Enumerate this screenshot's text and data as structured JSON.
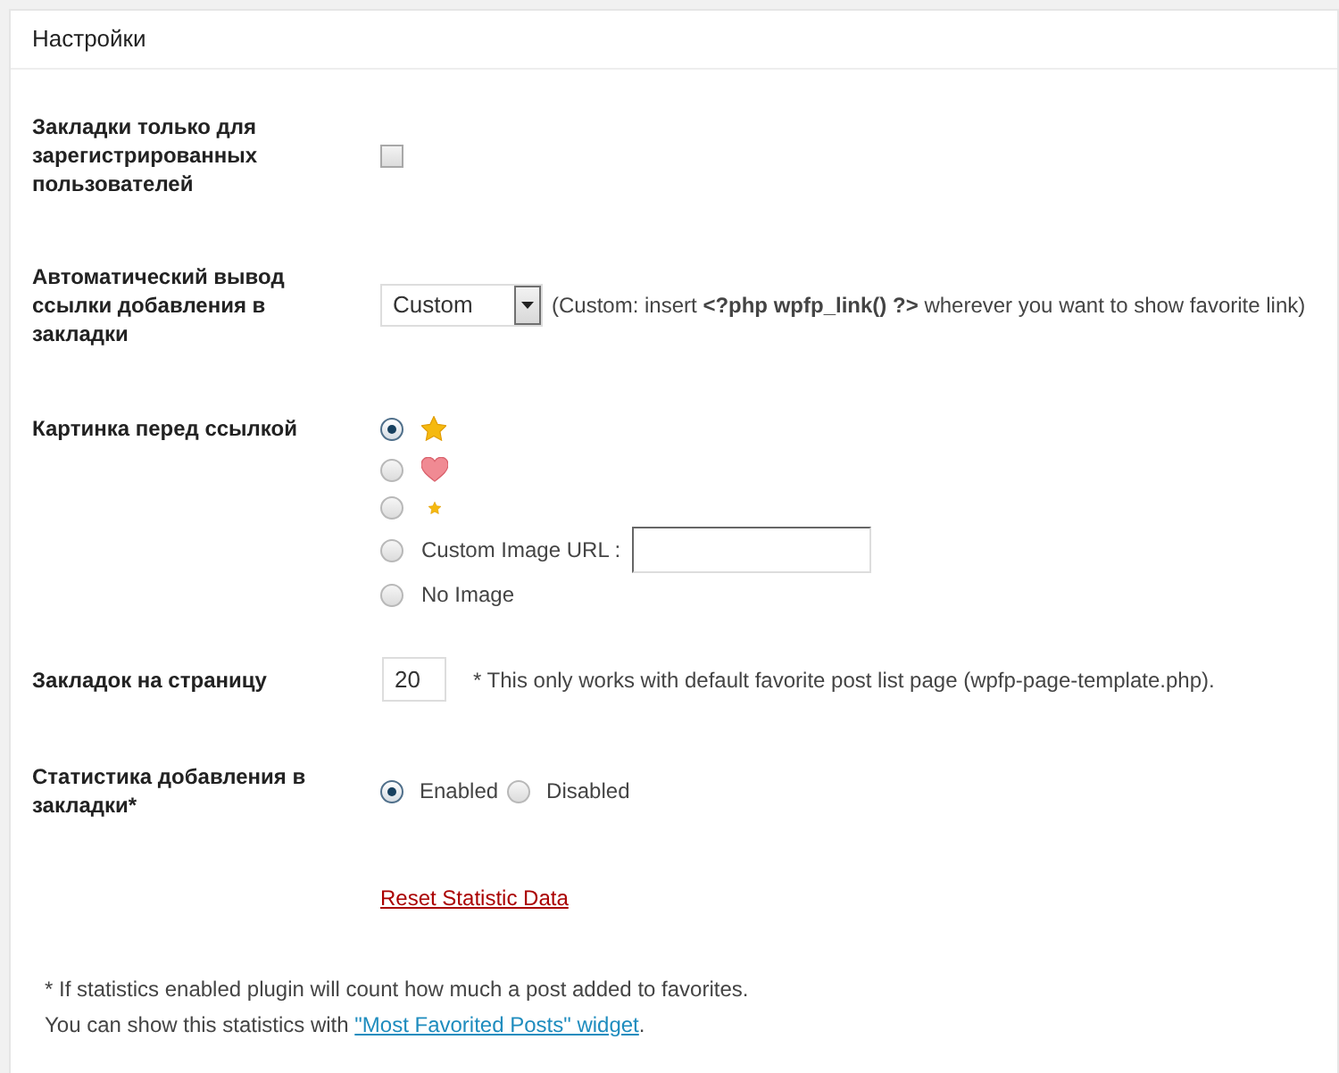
{
  "panel": {
    "title": "Настройки"
  },
  "settings": [
    {
      "kind": "checkbox",
      "label": "Закладки только для зарегистрированных пользователей",
      "checked": false
    },
    {
      "kind": "select",
      "label": "Автоматический вывод ссылки добавления в закладки",
      "value": "Custom",
      "note": "(Custom: insert **<?php wpfp_link() ?>** wherever you want to show favorite link)"
    },
    {
      "kind": "image_choice",
      "label": "Картинка перед ссылкой",
      "options": [
        {
          "kind": "star",
          "selected": true
        },
        {
          "kind": "heart",
          "selected": false
        },
        {
          "kind": "small_star",
          "selected": false
        },
        {
          "kind": "custom_url",
          "label": "Custom Image URL :",
          "selected": false
        },
        {
          "kind": "none",
          "label": "No Image",
          "selected": false
        }
      ]
    },
    {
      "kind": "number",
      "label": "Закладок на страницу",
      "value": "20",
      "note": "* This only works with default favorite post list page (wpfp-page-template.php)."
    },
    {
      "kind": "radio",
      "label": "Статистика добавления в закладки*",
      "options": [
        {
          "label": "Enabled",
          "selected": true
        },
        {
          "label": "Disabled",
          "selected": false
        }
      ]
    },
    {
      "kind": "link",
      "link": "Reset Statistic Data"
    }
  ],
  "footnote": {
    "line_1": "* If statistics enabled plugin will count how much a post added to favorites.",
    "line_2": {
      "before": "You can show this statistics with ",
      "link": "\"Most Favorited Posts\" widget",
      "after": "."
    }
  }
}
